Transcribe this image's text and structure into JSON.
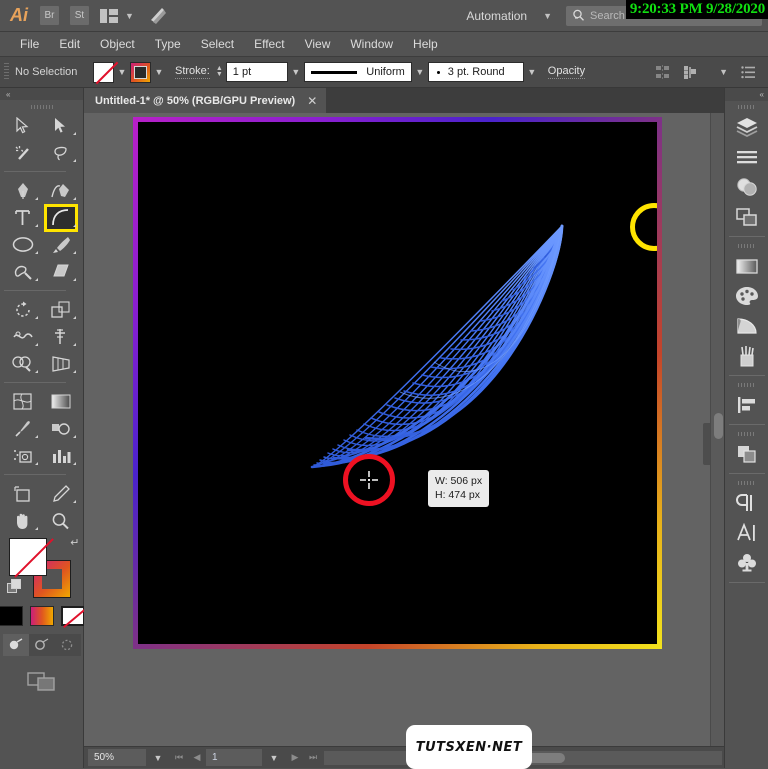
{
  "app": {
    "name": "Adobe Illustrator",
    "logo_text": "Ai",
    "bridge_button": "Br",
    "stock_button": "St",
    "workspace_label": "workspace-switcher",
    "automation_label": "Automation",
    "stock_search_placeholder": "Search Adobe Stock",
    "clock_overlay": "9:20:33 PM 9/28/2020"
  },
  "menu": {
    "items": [
      "File",
      "Edit",
      "Object",
      "Type",
      "Select",
      "Effect",
      "View",
      "Window",
      "Help"
    ]
  },
  "control_bar": {
    "selection_status": "No Selection",
    "fill_swatch": "none",
    "stroke_swatch": "gradient",
    "stroke_label": "Stroke:",
    "stroke_weight": "1 pt",
    "stroke_profile": "Uniform",
    "brush_definition": "3 pt. Round",
    "opacity_label": "Opacity",
    "align_icon": "align-icon",
    "distribute_icon": "distribute-icon",
    "options_icon": "options-menu-icon"
  },
  "document": {
    "tab_title": "Untitled-1* @ 50% (RGB/GPU Preview)",
    "close_label": "✕"
  },
  "canvas": {
    "artwork_name": "blue-feather-arc-artwork",
    "artboard_border": "gradient-magenta-yellow",
    "background_color": "#000000",
    "stroke_color": "#3b6df5",
    "tooltip": {
      "width": "W: 506 px",
      "height": "H: 474 px"
    },
    "annotations": [
      {
        "name": "red-highlight-circle",
        "color": "#ee1122"
      },
      {
        "name": "yellow-highlight-circle",
        "color": "#ffe400"
      }
    ]
  },
  "tools": {
    "column_left": [
      "selection-tool",
      "magic-wand-tool",
      "pen-tool",
      "type-tool",
      "ellipse-tool",
      "paintbrush-blob-tool",
      "rotate-tool",
      "width-tool",
      "shape-builder-tool",
      "mesh-tool",
      "eyedropper-tool",
      "artboard-tool",
      "slice-tool",
      "hand-tool"
    ],
    "column_right": [
      "direct-selection-tool",
      "lasso-tool",
      "curvature-tool",
      "arc-tool",
      "paintbrush-tool",
      "eraser-tool",
      "scale-tool",
      "free-transform-tool",
      "perspective-grid-tool",
      "gradient-tool",
      "blend-tool",
      "graph-tool",
      "pencil-tool",
      "zoom-tool"
    ],
    "selected_tool": "arc-tool",
    "fill_color": "none",
    "stroke_color": "gradient-magenta-orange",
    "mini_swatches": [
      "black",
      "gradient",
      "none"
    ],
    "draw_modes": [
      "draw-normal",
      "draw-behind",
      "draw-inside"
    ],
    "screen_mode": "screen-mode-icon"
  },
  "right_panel": {
    "groups": [
      {
        "icons": [
          "layers-icon",
          "properties-icon",
          "appearance-icon",
          "artboards-icon"
        ]
      },
      {
        "icons": [
          "gradient-icon",
          "color-icon",
          "color-guide-icon",
          "brushes-icon"
        ]
      },
      {
        "icons": [
          "align-panel-icon"
        ]
      },
      {
        "icons": [
          "pathfinder-icon"
        ]
      },
      {
        "icons": [
          "paragraph-icon",
          "character-icon",
          "symbols-icon"
        ]
      }
    ]
  },
  "status_bar": {
    "zoom_level": "50%",
    "artboard_number": "1",
    "first_label": "first-artboard",
    "prev_label": "previous-artboard",
    "next_label": "next-artboard",
    "last_label": "last-artboard",
    "watermark": "TUTSXEN·NET"
  }
}
